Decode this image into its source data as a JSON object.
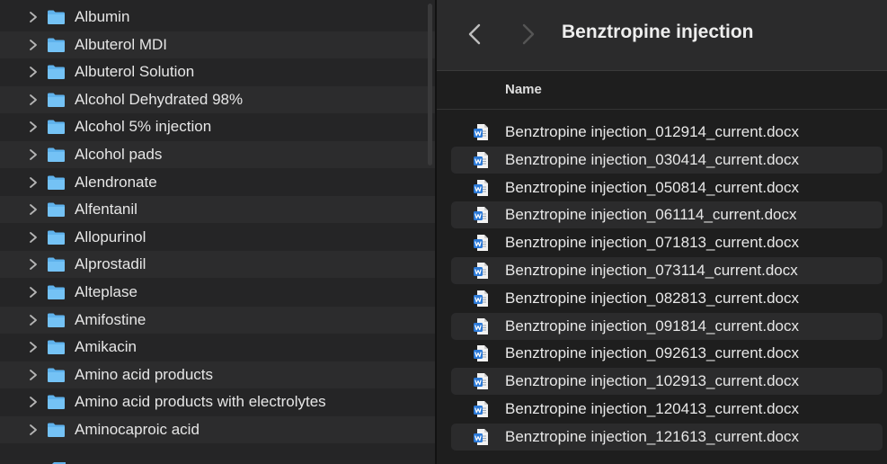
{
  "sidebar": {
    "folders": [
      "Albumin",
      "Albuterol MDI",
      "Albuterol Solution",
      "Alcohol  Dehydrated 98%",
      "Alcohol 5% injection",
      "Alcohol pads",
      "Alendronate",
      "Alfentanil",
      "Allopurinol",
      "Alprostadil",
      "Alteplase",
      "Amifostine",
      "Amikacin",
      "Amino acid products",
      "Amino acid products with electrolytes",
      "Aminocaproic acid"
    ]
  },
  "toolbar": {
    "back_icon": "chevron-left-icon",
    "forward_icon": "chevron-right-icon",
    "title": "Benztropine injection"
  },
  "list": {
    "column_name": "Name",
    "files": [
      "Benztropine injection_012914_current.docx",
      "Benztropine injection_030414_current.docx",
      "Benztropine injection_050814_current.docx",
      "Benztropine injection_061114_current.docx",
      "Benztropine injection_071813_current.docx",
      "Benztropine injection_073114_current.docx",
      "Benztropine injection_082813_current.docx",
      "Benztropine injection_091814_current.docx",
      "Benztropine injection_092613_current.docx",
      "Benztropine injection_102913_current.docx",
      "Benztropine injection_120413_current.docx",
      "Benztropine injection_121613_current.docx"
    ]
  },
  "colors": {
    "folder_blue": "#5fb2ec",
    "word_blue": "#2b79d7",
    "background": "#1e1e1e"
  }
}
